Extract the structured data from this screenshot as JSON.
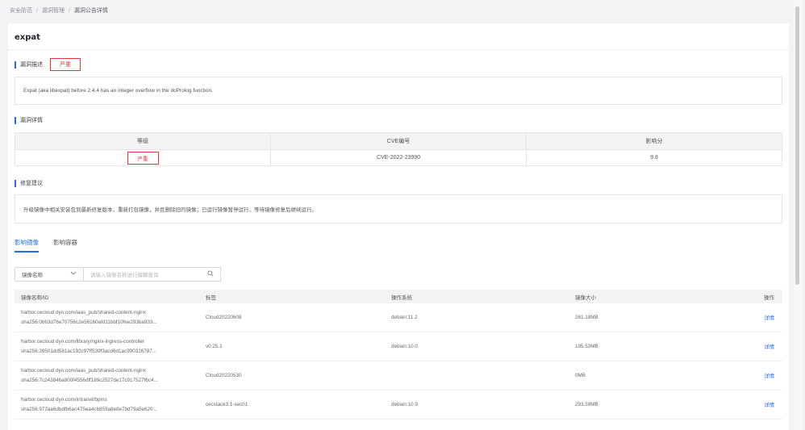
{
  "breadcrumb": {
    "items": [
      "安全防范",
      "漏洞管理",
      "漏洞公告详情"
    ],
    "sep": "/"
  },
  "page": {
    "title": "expat"
  },
  "description": {
    "label": "漏洞描述",
    "severity": "严重",
    "text": "Expat (aka libexpat) before 2.4.4 has an integer overflow in the doProlog function."
  },
  "details": {
    "label": "漏洞详情",
    "headers": [
      "等级",
      "CVE编号",
      "影响分"
    ],
    "severity": "严重",
    "cve": "CVE-2022-23990",
    "score": "9.8"
  },
  "fix": {
    "label": "修复建议",
    "text": "升级镜像中相关安装包到最新修复版本，重新打包镜像，并且删除旧的镜像；已运行镜像暂停运行，等待镜像修复后继续运行。"
  },
  "tabs": [
    "影响镜像",
    "影响容器"
  ],
  "filter": {
    "select_value": "镜像名称",
    "search_placeholder": "请输入镜像名称进行模糊查询"
  },
  "image_table": {
    "headers": [
      "镜像名称/ID",
      "标签",
      "操作系统",
      "镜像大小",
      "操作"
    ],
    "rows": [
      {
        "name": "harbor.cecloud dyn.com/iaas_pub/shared-content-nginx",
        "id": "sha256:0b63d76e70756c2e56160afd11bbf10fee293ba933...",
        "tag": "Cloud20220608",
        "os": "debian:11.2",
        "size": "261.18MB",
        "action": "详情"
      },
      {
        "name": "harbor.cecloud dyn.com/library/nginx-ingress-controller",
        "id": "sha256:39501dd581ac192c97ff539f3acd6d1ac990316787...",
        "tag": "v0.25.1",
        "os": "debian:10.0",
        "size": "195.53MB",
        "action": "详情"
      },
      {
        "name": "harbor.cecloud dyn.com/iaas_pub/shared-content-nginx",
        "id": "sha256:7c243846a800f4556dff189c2527de17c917527f6c4...",
        "tag": "Cloud20220530",
        "os": "",
        "size": "0MB",
        "action": "详情"
      },
      {
        "name": "harbor.cecloud dyn.com/intranet/bpms",
        "id": "sha256:972aa6dbdfb6ac475ea4c6859a8e8e7bd79a5e620...",
        "tag": "cecstack3.1-sec01",
        "os": "debian:10.9",
        "size": "293.59MB",
        "action": "详情"
      }
    ]
  },
  "colors": {
    "accent": "#1f6fe5",
    "danger": "#d9363e"
  }
}
